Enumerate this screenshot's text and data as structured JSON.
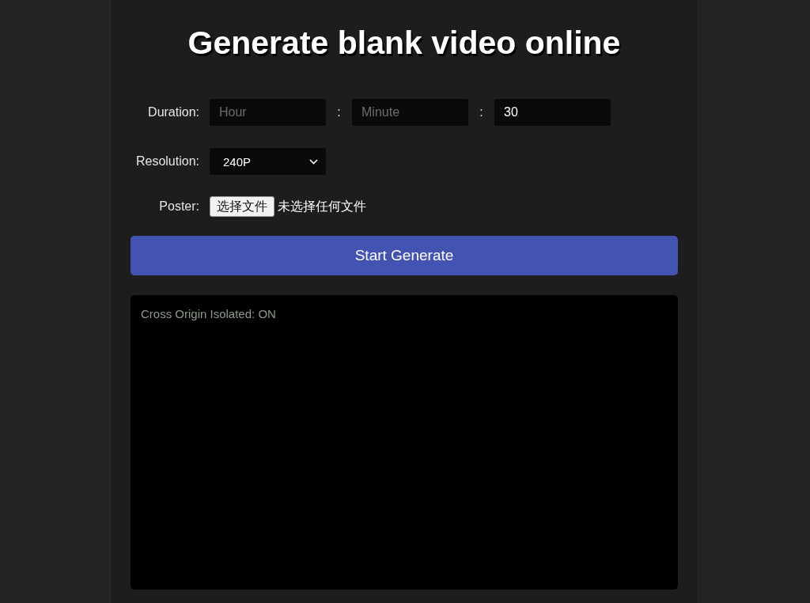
{
  "title": "Generate blank video online",
  "duration": {
    "label": "Duration:",
    "fields": [
      {
        "placeholder": "Hour"
      },
      {
        "placeholder": "Minute"
      },
      {
        "value": "30"
      }
    ],
    "separators": [
      ":",
      ":"
    ]
  },
  "resolution": {
    "label": "Resolution:",
    "value": "240P"
  },
  "poster": {
    "label": "Poster:",
    "button": "选择文件",
    "status": "未选择任何文件"
  },
  "generate_button": "Start Generate",
  "log": {
    "lines": [
      "Cross Origin Isolated: ON"
    ]
  }
}
